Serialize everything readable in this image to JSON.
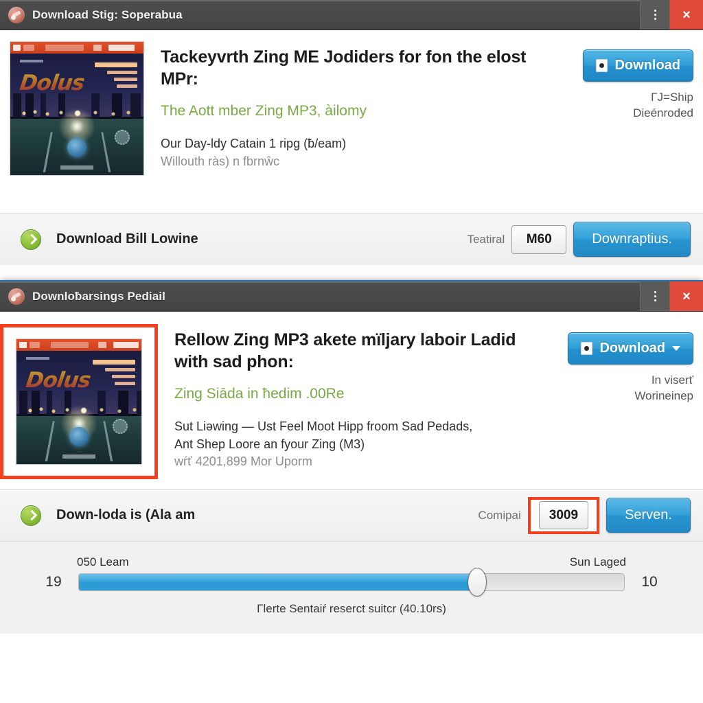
{
  "windows": [
    {
      "id": "window-1",
      "title": "Download Stig: Soperabua",
      "icon": "app-icon",
      "controls": {
        "menu": "⋮",
        "close": "×"
      },
      "album_art": {
        "logo_text": "Dolus",
        "alt": "album-cover-night-city-bridge"
      },
      "headline": "Tackeyvrth Zing ME Jodiders for fon the elost MPr:",
      "subline": "The Aott mber Zing MP3, àilomy",
      "desc_line_1": "Our Day-ldy Catain 1 ripg (ƀ/eam)",
      "desc_line_2": "Willouth ràs) n fbrnŵc",
      "cta": {
        "label": "Download",
        "has_caret": false,
        "sub_line_1": "ΓJ=Ship",
        "sub_line_2": "Dieénroded"
      },
      "footer": {
        "label": "Download Bill Lowine",
        "note": "Teatiral",
        "qty": "M60",
        "qty_highlighted": false,
        "button": "Downraptius."
      }
    },
    {
      "id": "window-2",
      "title": "Downloƀarsings Pediail",
      "icon": "app-icon",
      "controls": {
        "menu": "⋮",
        "close": "×"
      },
      "album_art": {
        "logo_text": "Dolus",
        "alt": "album-cover-night-city-bridge"
      },
      "art_highlighted": true,
      "headline": "Rellow Zing MP3 akete mïljary laboir Ladid with sad phon:",
      "subline": "Zing Siāda in ħedim .00Re",
      "desc_line_1": "Sut Liəwing — Ust Feel Moot Hipp froom Sad Pedads,",
      "desc_line_2": "Ant Shep Loore an fyour Zing (M3)",
      "desc_line_3": "wŕť 4201,899 Mor Uporm",
      "cta": {
        "label": "Download",
        "has_caret": true,
        "sub_line_1": "In viserť",
        "sub_line_2": "Worineinep"
      },
      "footer": {
        "label": "Down-loda is (Ala am",
        "note": "Comipai",
        "qty": "3009",
        "qty_highlighted": true,
        "button": "Serven."
      },
      "slider": {
        "left_cap": "050 Leam",
        "right_cap": "Sun Laged",
        "left_value": "19",
        "right_value": "10",
        "fill_percent": 73,
        "caption": "Γlerte Sentaiŕ reserct suitcr (40.10rs)"
      }
    }
  ],
  "colors": {
    "titlebar": "#4a4a4a",
    "close_red": "#e04a3a",
    "accent_blue": "#2e9ed8",
    "green_text": "#7aa844",
    "highlight_red": "#f4401f",
    "green_icon": "#8dbf3a"
  }
}
